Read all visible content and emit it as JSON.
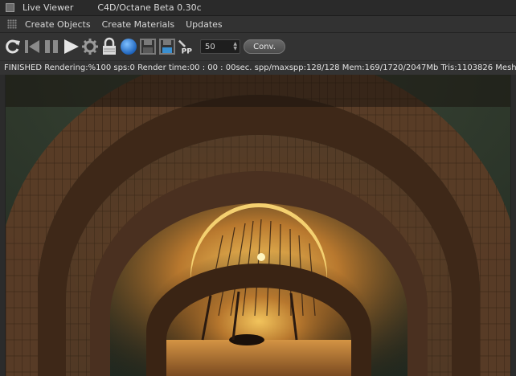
{
  "window": {
    "title": "Live Viewer",
    "app_title": "C4D/Octane Beta 0.30c"
  },
  "menu": {
    "items": [
      "Create Objects",
      "Create Materials",
      "Updates"
    ]
  },
  "toolbar": {
    "icons": [
      "refresh-icon",
      "rewind-icon",
      "pause-icon",
      "play-icon",
      "gear-icon",
      "lock-icon",
      "sphere-icon",
      "save-icon",
      "save-all-icon",
      "pp-icon"
    ],
    "pp_label": "PP",
    "spin_value": "50",
    "conv_label": "Conv."
  },
  "status": {
    "text": "FINISHED Rendering:%100 sps:0 Render time:00 : 00 : 00sec. spp/maxspp:128/128 Mem:169/1720/2047Mb Tris:1103826 Meshe"
  },
  "colors": {
    "sky": "#2e3a2c",
    "sunset": "#e8a040",
    "wood": "#6a4a30"
  }
}
